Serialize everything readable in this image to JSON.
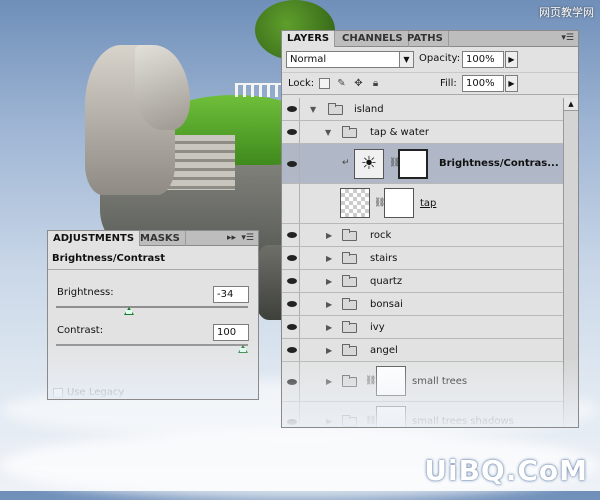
{
  "watermark": {
    "site": "网页教学网",
    "domain": "UiBQ.CoM"
  },
  "layers_panel": {
    "tabs": [
      {
        "label": "LAYERS",
        "active": true
      },
      {
        "label": "CHANNELS",
        "active": false
      },
      {
        "label": "PATHS",
        "active": false
      }
    ],
    "menu_icon": "panel-menu-icon",
    "blend_mode": "Normal",
    "opacity_label": "Opacity:",
    "opacity_value": "100%",
    "lock_label": "Lock:",
    "fill_label": "Fill:",
    "fill_value": "100%",
    "layers": [
      {
        "name": "island",
        "type": "group",
        "expanded": true,
        "indent": 0
      },
      {
        "name": "tap & water",
        "type": "group",
        "expanded": true,
        "indent": 1
      },
      {
        "name": "Brightness/Contras...",
        "type": "adjustment",
        "selected": true,
        "indent": 2
      },
      {
        "name": "tap",
        "type": "layer-with-mask",
        "indent": 2
      },
      {
        "name": "rock",
        "type": "group",
        "expanded": false,
        "indent": 1
      },
      {
        "name": "stairs",
        "type": "group",
        "expanded": false,
        "indent": 1
      },
      {
        "name": "quartz",
        "type": "group",
        "expanded": false,
        "indent": 1
      },
      {
        "name": "bonsai",
        "type": "group",
        "expanded": false,
        "indent": 1
      },
      {
        "name": "ivy",
        "type": "group",
        "expanded": false,
        "indent": 1
      },
      {
        "name": "angel",
        "type": "group",
        "expanded": false,
        "indent": 1
      },
      {
        "name": "small trees",
        "type": "group-with-mask",
        "expanded": false,
        "indent": 1
      },
      {
        "name": "small trees shadows",
        "type": "group-with-mask",
        "expanded": false,
        "indent": 1
      }
    ]
  },
  "adjustments_panel": {
    "tabs": [
      {
        "label": "ADJUSTMENTS",
        "active": true
      },
      {
        "label": "MASKS",
        "active": false
      }
    ],
    "title": "Brightness/Contrast",
    "brightness_label": "Brightness:",
    "brightness_value": "-34",
    "brightness_fraction": 0.38,
    "contrast_label": "Contrast:",
    "contrast_value": "100",
    "contrast_fraction": 1.0,
    "use_legacy_label": "Use Legacy",
    "use_legacy_checked": false
  }
}
